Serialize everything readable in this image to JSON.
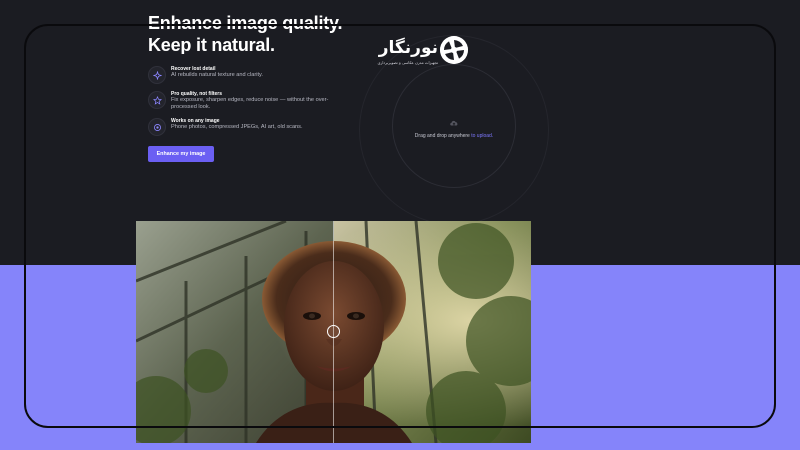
{
  "hero": {
    "title_line1": "Enhance image quality.",
    "title_line2": "Keep it natural."
  },
  "features": [
    {
      "icon": "sparkle-icon",
      "title": "Recover lost detail",
      "description": "AI rebuilds natural texture and clarity."
    },
    {
      "icon": "star-icon",
      "title": "Pro quality, not filters",
      "description": "Fix exposure, sharpen edges, reduce noise — without the over-processed look."
    },
    {
      "icon": "camera-icon",
      "title": "Works on any image",
      "description": "Phone photos, compressed JPEGs, AI art, old scans."
    }
  ],
  "cta": {
    "label": "Enhance my image"
  },
  "upload": {
    "text": "Drag and drop anywhere ",
    "link": "to upload."
  },
  "watermark": {
    "name": "نورنگار",
    "tagline": "تجهیزات مدرن عکاسی و تصویربرداری"
  },
  "colors": {
    "background_dark": "#1b1c22",
    "background_band": "#8584fa",
    "accent": "#6b5ff3",
    "link": "#7e78ff"
  },
  "comparison": {
    "split_position": 0.5
  }
}
